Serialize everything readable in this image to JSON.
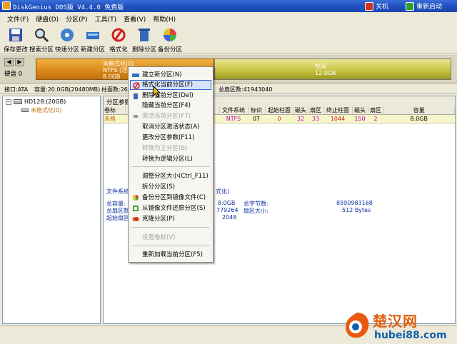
{
  "window": {
    "title": "DiskGenius DOS版 V4.4.0 免费版",
    "shutdown_label": "关机",
    "restart_label": "重新启动"
  },
  "menu": [
    "文件(F)",
    "硬盘(D)",
    "分区(P)",
    "工具(T)",
    "查看(V)",
    "帮助(H)"
  ],
  "toolbar": [
    "保存更改",
    "搜索分区",
    "快速分区",
    "新建分区",
    "格式化",
    "删除分区",
    "备份分区"
  ],
  "diskbar": {
    "disk_label": "硬盘 0",
    "part1": {
      "name": "未格式化(0)",
      "fs": "NTFS (活动)",
      "size": "8.0GB"
    },
    "part2": {
      "name": "空闲",
      "size": "12.0GB"
    }
  },
  "diskinfo": {
    "interface": "接口:ATA",
    "capacity": "容量:20.0GB(20480MB)",
    "cyl": "柱面数:26",
    "sectors": "总扇区数:41943040"
  },
  "tree": {
    "disk": "HD128:(20GB)",
    "partition": "未格式化(0)"
  },
  "panel": {
    "tab": "分区参数",
    "columns": [
      "卷标",
      "",
      "文件系统",
      "标识",
      "起始柱面",
      "磁头",
      "扇区",
      "终止柱面",
      "磁头",
      "扇区",
      "容量"
    ],
    "row": {
      "label": "未格",
      "fs": "NTFS",
      "id": "07",
      "start_cyl": "0",
      "head1": "32",
      "sec1": "33",
      "end_cyl": "1044",
      "head2": "150",
      "sec2": "2",
      "size": "8.0GB"
    },
    "fs_type_label": "文件系统",
    "fs_type_tail": "式化)",
    "detail_left": [
      "总容量:",
      "总扇区数",
      "起始扇区"
    ],
    "detail_vals": [
      "8.0GB",
      "779264",
      "2048"
    ],
    "detail_right_labels": [
      "总字节数:",
      "扇区大小:"
    ],
    "detail_right_vals": [
      "8590983168",
      "512 Bytes"
    ]
  },
  "context_menu": [
    {
      "label": "建立新分区(N)",
      "disabled": false,
      "icon": "new"
    },
    {
      "label": "格式化当前分区(F)",
      "disabled": false,
      "icon": "format"
    },
    {
      "label": "删除当前分区(Del)",
      "disabled": false,
      "icon": "delete"
    },
    {
      "label": "隐藏当前分区(F4)",
      "disabled": false,
      "icon": ""
    },
    {
      "label": "激活当前分区(F7)",
      "disabled": true,
      "icon": "activate"
    },
    {
      "label": "取消分区激活状态(A)",
      "disabled": false,
      "icon": ""
    },
    {
      "label": "更改分区参数(F11)",
      "disabled": false,
      "icon": ""
    },
    {
      "label": "转换为主分区(B)",
      "disabled": true,
      "icon": ""
    },
    {
      "label": "转换为逻辑分区(L)",
      "disabled": false,
      "icon": ""
    },
    {
      "label": "调整分区大小(Ctrl_F11)",
      "disabled": false,
      "icon": ""
    },
    {
      "label": "拆分分区(S)",
      "disabled": false,
      "icon": ""
    },
    {
      "label": "备份分区到镜像文件(C)",
      "disabled": false,
      "icon": "backup"
    },
    {
      "label": "从镜像文件还原分区(S)",
      "disabled": false,
      "icon": "restore"
    },
    {
      "label": "克隆分区(P)",
      "disabled": false,
      "icon": "clone"
    },
    {
      "label": "设置卷标(V)",
      "disabled": true,
      "icon": ""
    },
    {
      "label": "重新加载当前分区(F5)",
      "disabled": false,
      "icon": ""
    }
  ],
  "watermark": {
    "cn": "楚汉网",
    "url": "hubei88.com"
  },
  "colors": {
    "titlebar": "#1E50C0",
    "part1": "#D88818",
    "part2": "#C4C040",
    "highlight_border": "#3366CC"
  }
}
